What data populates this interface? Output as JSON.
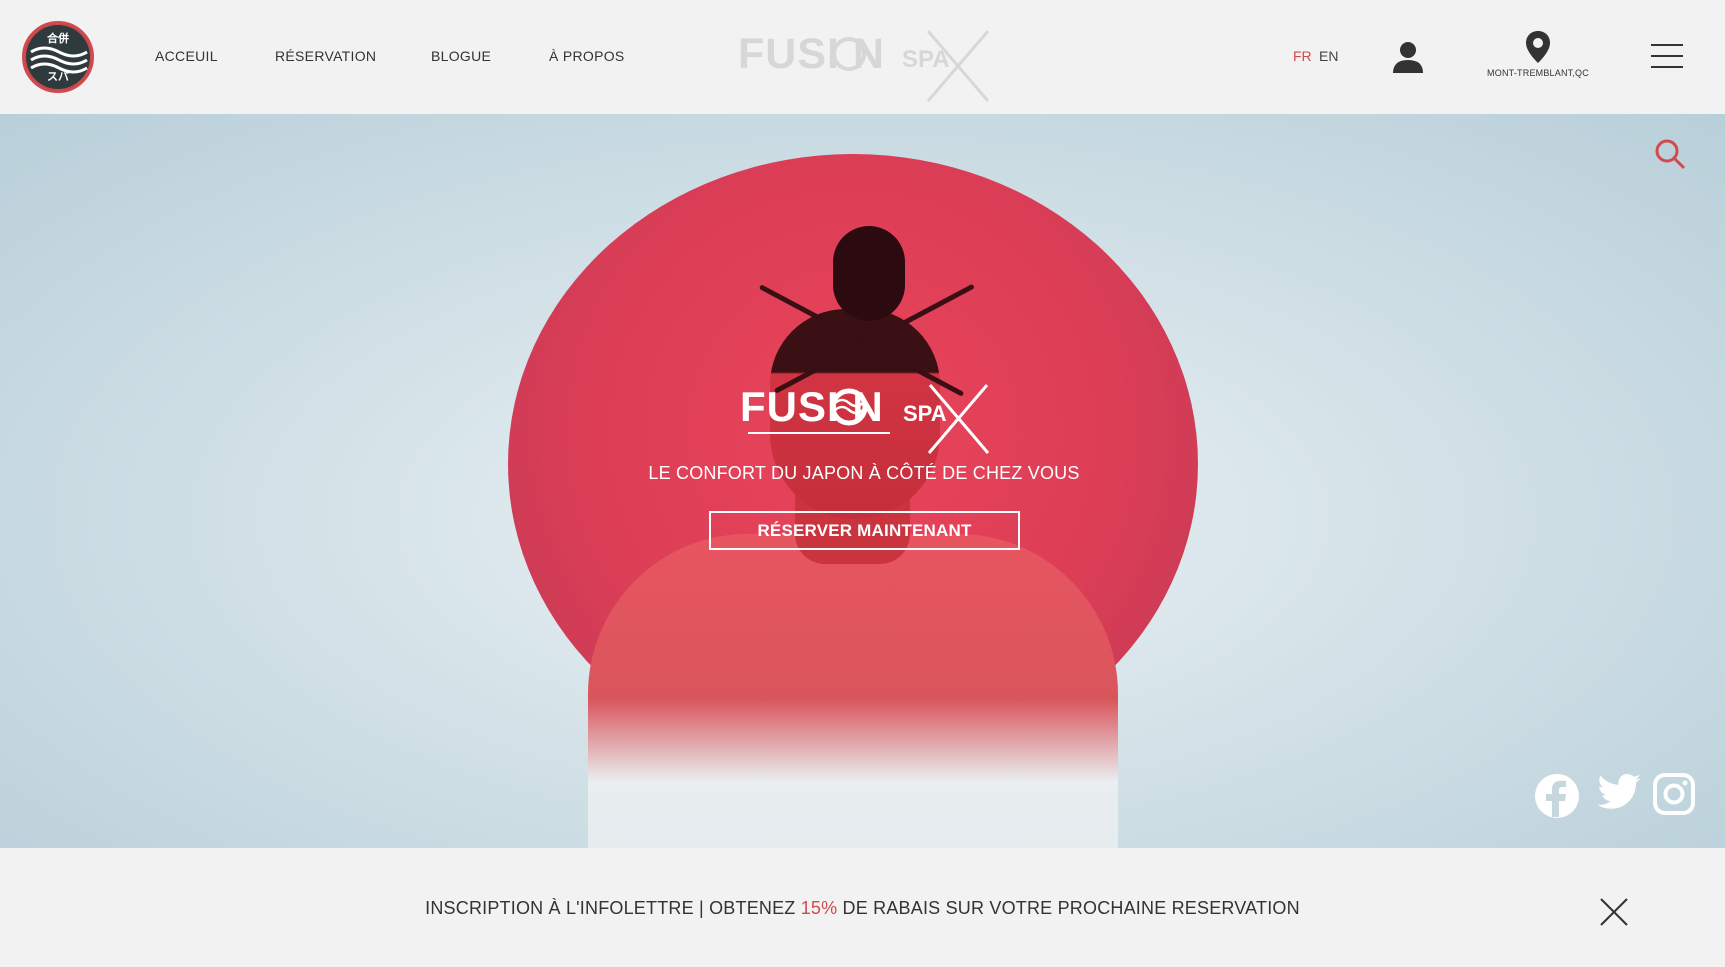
{
  "header": {
    "badge": {
      "top": "合併",
      "bottom": "スパ"
    },
    "nav": [
      {
        "label": "ACCEUIL"
      },
      {
        "label": "RÉSERVATION"
      },
      {
        "label": "BLOGUE"
      },
      {
        "label": "À PROPOS"
      }
    ],
    "logo": {
      "word": "FUSI N",
      "spa": "SPA"
    },
    "lang": {
      "fr": "FR",
      "en": "EN",
      "active": "FR"
    },
    "location": "MONT-TREMBLANT,QC",
    "icons": [
      "user-icon",
      "location-pin-icon",
      "menu-icon"
    ]
  },
  "hero": {
    "logo": {
      "word": "FUSI N",
      "spa": "SPA"
    },
    "tagline": "LE CONFORT DU JAPON À CÔTÉ DE CHEZ VOUS",
    "cta": "RÉSERVER MAINTENANT",
    "icons": [
      "search-icon",
      "facebook-icon",
      "twitter-icon",
      "instagram-icon"
    ]
  },
  "newsletter": {
    "before": "INSCRIPTION À L'INFOLETTRE | OBTENEZ ",
    "highlight": "15%",
    "after": " DE RABAIS SUR VOTRE PROCHAINE RESERVATION"
  },
  "colors": {
    "accent": "#d24a4f",
    "text": "#333333",
    "bar": "#f2f2f2"
  }
}
